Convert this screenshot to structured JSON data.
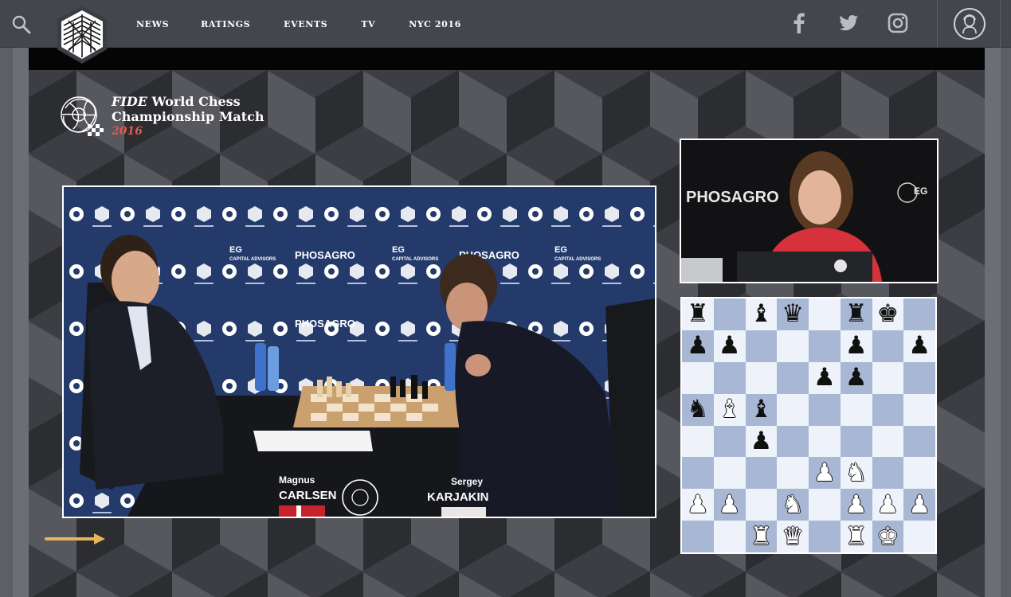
{
  "nav": {
    "items": [
      "NEWS",
      "RATINGS",
      "EVENTS",
      "TV",
      "NYC 2016"
    ],
    "icons": [
      "search-icon",
      "facebook-icon",
      "twitter-icon",
      "instagram-icon",
      "profile-icon"
    ]
  },
  "branding": {
    "line1_italic": "FIDE",
    "line1": " World Chess",
    "line2": "Championship Match",
    "year": "2016"
  },
  "broadcast": {
    "sponsor": "PHOSAGRO",
    "sponsor2": "EG",
    "sponsor2_sub": "CAPITAL ADVISORS",
    "player_left_first": "Magnus",
    "player_left_last": "CARLSEN",
    "player_right_first": "Sergey",
    "player_right_last": "KARJAKIN"
  },
  "board": {
    "rows": [
      [
        "bR",
        "",
        "bB",
        "bQ",
        "",
        "bR",
        "bK",
        ""
      ],
      [
        "bP",
        "bP",
        "",
        "",
        "",
        "bP",
        "",
        "bP"
      ],
      [
        "",
        "",
        "",
        "",
        "bP",
        "bP",
        "",
        ""
      ],
      [
        "bN",
        "wB",
        "bB",
        "",
        "",
        "",
        "",
        ""
      ],
      [
        "",
        "",
        "bP",
        "",
        "",
        "",
        "",
        ""
      ],
      [
        "",
        "",
        "",
        "",
        "wP",
        "wN",
        "",
        ""
      ],
      [
        "wP",
        "wP",
        "",
        "wN",
        "",
        "wP",
        "wP",
        "wP"
      ],
      [
        "",
        "",
        "wR",
        "wQ",
        "",
        "wR",
        "wK",
        ""
      ]
    ],
    "arrow_color": "#e8b45a",
    "light_color": "#eef2fa",
    "dark_color": "#a8b8d4"
  },
  "colors": {
    "topbar": "#43464d",
    "accent_year": "#e05a4d"
  }
}
